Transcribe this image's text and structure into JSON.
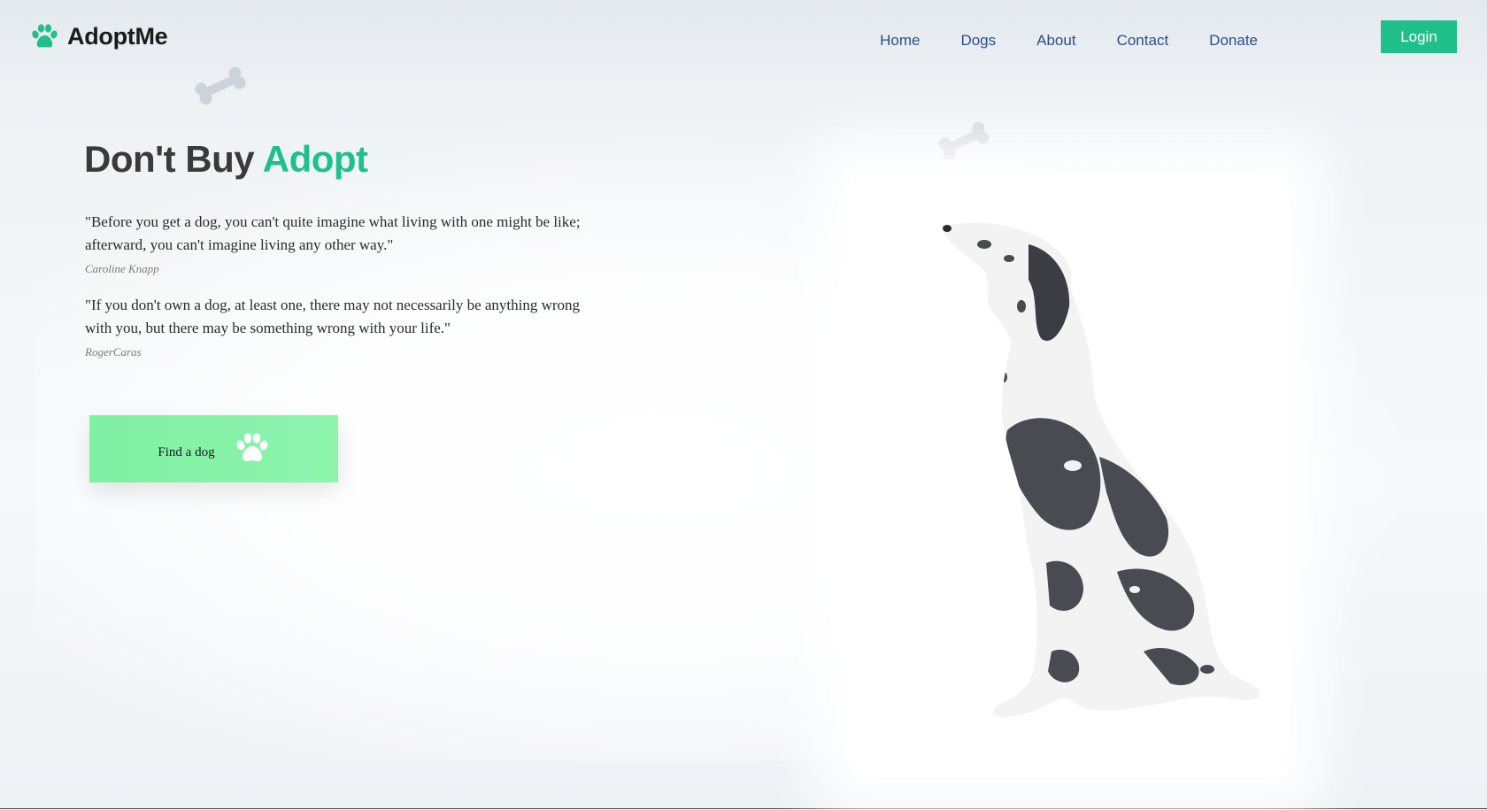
{
  "brand": {
    "name": "AdoptMe",
    "icon": "paw-icon",
    "accent_color": "#20c08a"
  },
  "nav": {
    "items": [
      {
        "label": "Home"
      },
      {
        "label": "Dogs"
      },
      {
        "label": "About"
      },
      {
        "label": "Contact"
      },
      {
        "label": "Donate"
      }
    ],
    "login_label": "Login"
  },
  "hero": {
    "title_part1": "Don't Buy ",
    "title_accent": "Adopt",
    "quotes": [
      {
        "text": "\"Before you get a dog, you can't quite imagine what living with one might be like; afterward, you can't imagine living any other way.\"",
        "author": "Caroline Knapp"
      },
      {
        "text": "\"If you don't own a dog, at least one, there may not necessarily be anything wrong with you, but there may be something wrong with your life.\"",
        "author": "RogerCaras"
      }
    ],
    "cta_label": "Find a dog",
    "cta_icon": "paw-icon"
  },
  "decorations": {
    "bone_icon": "bone-icon",
    "image": "great-dane-dog-image"
  }
}
